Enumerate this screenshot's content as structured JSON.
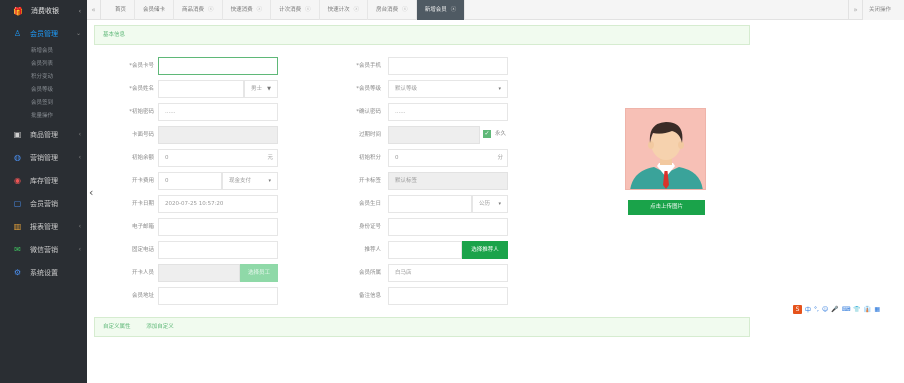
{
  "sidebar": {
    "logo": {
      "icon": "gift-icon",
      "label": "消费收银"
    },
    "menu": [
      {
        "label": "会员管理",
        "icon": "user-icon",
        "active": true
      },
      {
        "label": "商品管理",
        "icon": "box-icon"
      },
      {
        "label": "营销管理",
        "icon": "globe-icon"
      },
      {
        "label": "库存管理",
        "icon": "stock-icon"
      },
      {
        "label": "会员营销",
        "icon": "tag-icon"
      },
      {
        "label": "报表管理",
        "icon": "chart-icon"
      },
      {
        "label": "微信营销",
        "icon": "wechat-icon"
      },
      {
        "label": "系统设置",
        "icon": "gear-icon"
      }
    ],
    "submenu": [
      "新增会员",
      "会员列表",
      "积分变动",
      "会员等级",
      "会员签到",
      "批量操作"
    ]
  },
  "tabs": [
    {
      "label": "首页",
      "closable": false
    },
    {
      "label": "会员储卡",
      "closable": false
    },
    {
      "label": "商品消费",
      "closable": true
    },
    {
      "label": "快速消费",
      "closable": true
    },
    {
      "label": "计次消费",
      "closable": true
    },
    {
      "label": "快速计次",
      "closable": true
    },
    {
      "label": "房台消费",
      "closable": true
    },
    {
      "label": "新增会员",
      "closable": true,
      "active": true
    }
  ],
  "close_ops": "关闭操作",
  "section_top": {
    "label": "基本信息"
  },
  "section_bottom": {
    "tabs": [
      "自定义属性",
      "添加自定义"
    ]
  },
  "form": {
    "card_no": {
      "label": "*会员卡号",
      "value": ""
    },
    "phone": {
      "label": "*会员手机",
      "value": ""
    },
    "name": {
      "label": "*会员姓名",
      "value": ""
    },
    "gender": {
      "value": "男士"
    },
    "level": {
      "label": "*会员等级",
      "value": "默认等级"
    },
    "init_password": {
      "label": "*初始密码",
      "value": "......"
    },
    "confirm_password": {
      "label": "*确认密码",
      "value": "......"
    },
    "card_face": {
      "label": "卡面号码",
      "value": ""
    },
    "expire": {
      "label": "过期时间",
      "value": "",
      "checkbox_label": "永久"
    },
    "init_balance": {
      "label": "初始余额",
      "value": "0",
      "suffix": "元"
    },
    "init_points": {
      "label": "初始积分",
      "value": "0",
      "suffix": "分"
    },
    "card_fee": {
      "label": "开卡费用",
      "value": "0",
      "select": "现金支付"
    },
    "card_label": {
      "label": "开卡标签",
      "value": "默认标签"
    },
    "card_date": {
      "label": "开卡日期",
      "value": "2020-07-25 10:57:20"
    },
    "birthday": {
      "label": "会员生日",
      "select": "公历"
    },
    "email": {
      "label": "电子邮箱",
      "value": ""
    },
    "id_card": {
      "label": "身份证号",
      "value": ""
    },
    "address": {
      "label": "固定电话",
      "value": ""
    },
    "referrer": {
      "label": "推荐人",
      "value": "",
      "button": "选择推荐人"
    },
    "staff": {
      "label": "开卡人员",
      "value": "",
      "button": "选择员工"
    },
    "store": {
      "label": "会员所属",
      "value": "白马店"
    },
    "address2": {
      "label": "会员地址",
      "value": ""
    },
    "remark": {
      "label": "备注信息",
      "value": ""
    }
  },
  "avatar": {
    "icon": "person-avatar-icon",
    "button": "点击上传图片"
  },
  "ime": {
    "items": [
      "中",
      "°,",
      "☺",
      "🎤",
      "⌨",
      "👕",
      "👔",
      "▦"
    ]
  },
  "colors": {
    "accent_green": "#1aa34a",
    "sidebar_bg": "#2a2e33",
    "active_blue": "#1e9fff"
  }
}
